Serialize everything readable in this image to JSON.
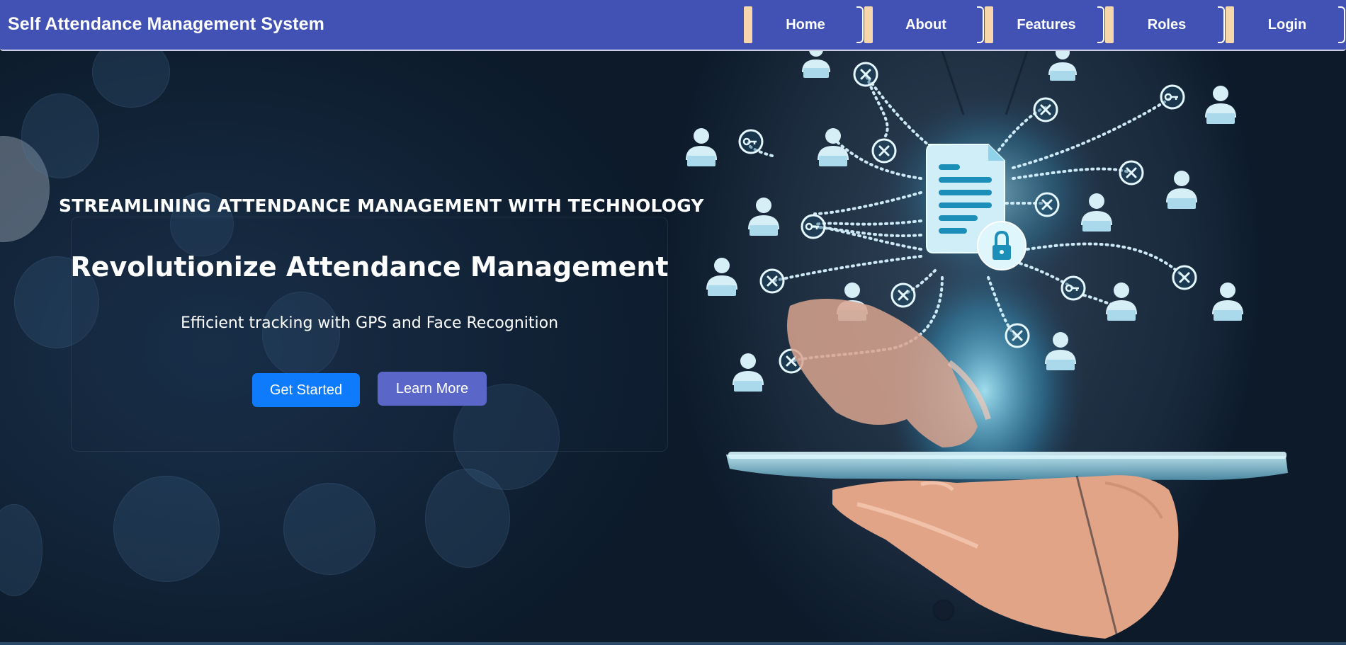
{
  "navbar": {
    "brand": "Self Attendance Management System",
    "links": [
      {
        "label": "Home"
      },
      {
        "label": "About"
      },
      {
        "label": "Features"
      },
      {
        "label": "Roles"
      },
      {
        "label": "Login"
      }
    ]
  },
  "hero": {
    "tagline": "STREAMLINING ATTENDANCE MANAGEMENT WITH TECHNOLOGY",
    "title": "Revolutionize Attendance Management",
    "subtitle": "Efficient tracking with GPS and Face Recognition",
    "primary_button": "Get Started",
    "secondary_button": "Learn More"
  },
  "colors": {
    "navbar": "#4152b4",
    "nav_tab": "#f5d7ab",
    "primary_button": "#0d7bfb",
    "secondary_button": "#5a67c8",
    "network_glow": "#7fdcff"
  },
  "illustration": {
    "icons": [
      "document-icon",
      "lock-icon",
      "user-icon",
      "key-icon",
      "close-icon",
      "tablet",
      "hand"
    ]
  }
}
